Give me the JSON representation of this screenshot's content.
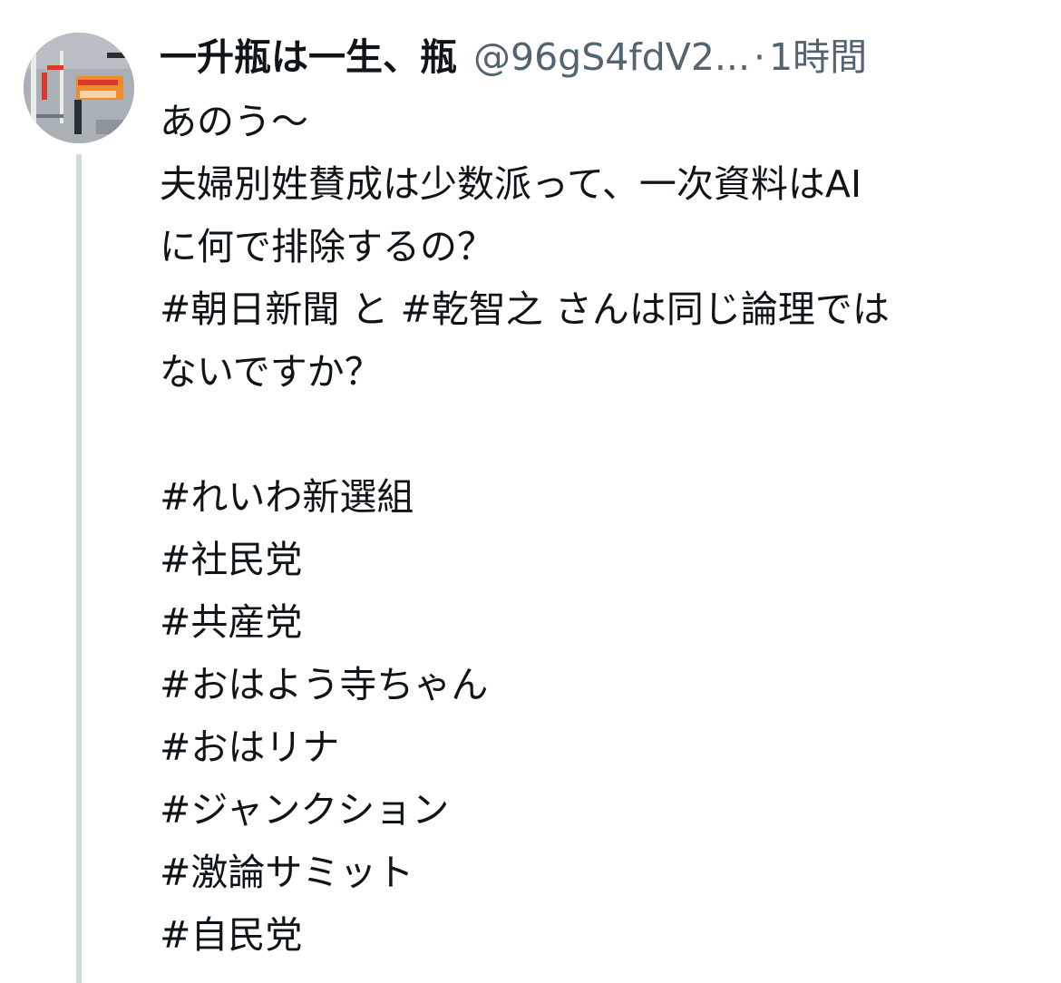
{
  "tweet": {
    "author": {
      "display_name": "一升瓶は一生、瓶",
      "handle": "@96gS4fdV2...",
      "separator": "·",
      "time": "1時間"
    },
    "avatar": {
      "colors": {
        "background": "#a9b0b6",
        "accent_red": "#d63a2a",
        "accent_orange": "#f08a2c",
        "dark": "#2a2f36",
        "light": "#e9ece8"
      }
    },
    "body": {
      "line1": "あのう〜",
      "line2": "夫婦別姓賛成は少数派って、一次資料はAI",
      "line3": "に何で排除するの？",
      "line4": {
        "tag1": "#朝日新聞",
        "mid": " と ",
        "tag2": "#乾智之",
        "rest": " さんは同じ論理では"
      },
      "line5": "ないですか？"
    },
    "hashtags": [
      "#れいわ新選組",
      "#社民党",
      "#共産党",
      "#おはよう寺ちゃん",
      "#おはリナ",
      "#ジャンクション",
      "#激論サミット",
      "#自民党"
    ],
    "colors": {
      "text": "#0f1419",
      "secondary": "#536471",
      "thread_line": "#cfd9de"
    }
  }
}
